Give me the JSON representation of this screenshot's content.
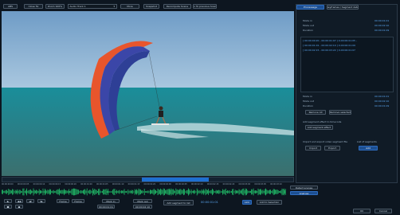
{
  "toolbar": {
    "left_btn": "ABS",
    "close_btn": "Close fix",
    "zoom_btn": "Zoom 100%",
    "track_select": "Audio Track 1",
    "more_btn": "More",
    "snapshot_btn": "Snapshot",
    "recompute_btn": "Recompute Scene",
    "goto_btn": "Go To previous Scene"
  },
  "right_tabs": [
    "Processage",
    "Keyframes / Segment data"
  ],
  "info_top": [
    {
      "label": "Mode in",
      "value": "00:00:01:01"
    },
    {
      "label": "Mode out",
      "value": "00:00:02:10"
    },
    {
      "label": "Duration",
      "value": "00:00:01:09"
    }
  ],
  "segments_list": [
    "[ 00:00:00:20 - 00:00:01:07 ] 0.00:00:01:05 -",
    "[ 00:00:01:01 - 00:00:02:10 ] 0.00:00:01:09",
    "[ 00:00:02:15 - 00:00:03:22 ] 0.00:00:01:07"
  ],
  "info_mid": [
    {
      "label": "Mode in",
      "value": "00:00:01:01"
    },
    {
      "label": "Mode out",
      "value": "00:00:02:10"
    },
    {
      "label": "Duration",
      "value": "00:00:01:09"
    }
  ],
  "mid_buttons": [
    "Remove All",
    "Remove selected"
  ],
  "effect_section": {
    "title": "Add segment effect to timecode",
    "button": "Add segment effect"
  },
  "import_section": {
    "title": "Import and export video segment file",
    "buttons": [
      "Import",
      "Export"
    ]
  },
  "list_section": {
    "title": "List of segments",
    "button": "Add"
  },
  "timeline": {
    "ticks": [
      "00:00:00:00",
      "00:00:00:05",
      "00:00:00:10",
      "00:00:00:15",
      "00:00:00:20",
      "00:00:01:00",
      "00:00:01:05",
      "00:00:01:10",
      "00:00:01:15",
      "00:00:01:20",
      "00:00:02:00",
      "00:00:02:05",
      "00:00:02:10",
      "00:00:02:15",
      "00:00:02:20",
      "00:00:03:00",
      "00:00:03:05",
      "00:00:03:10"
    ],
    "selection_start_fraction": 0.48,
    "selection_end_fraction": 0.71,
    "side_buttons": [
      "Detect scenes",
      "Analyse"
    ]
  },
  "transport": {
    "row1": [
      "▶",
      "◀◀",
      "◀|",
      "|▶",
      "Frame",
      "Frame"
    ],
    "row2": [
      "■",
      "●"
    ],
    "mark_in": "Mark In",
    "mark_in_time": "00:00:01:01",
    "mark_out": "Mark out",
    "mark_out_time": "00:00:02:10",
    "add_segment": "Add segment to list",
    "current_time": "00:00:01:01",
    "link_btn": "Link",
    "add_segment2": "Add to Selection"
  },
  "dialog_buttons": [
    "OK",
    "Cancel"
  ],
  "colors": {
    "accent": "#1f6fd1",
    "waveform": "#22c46b",
    "background": "#0d1620"
  }
}
